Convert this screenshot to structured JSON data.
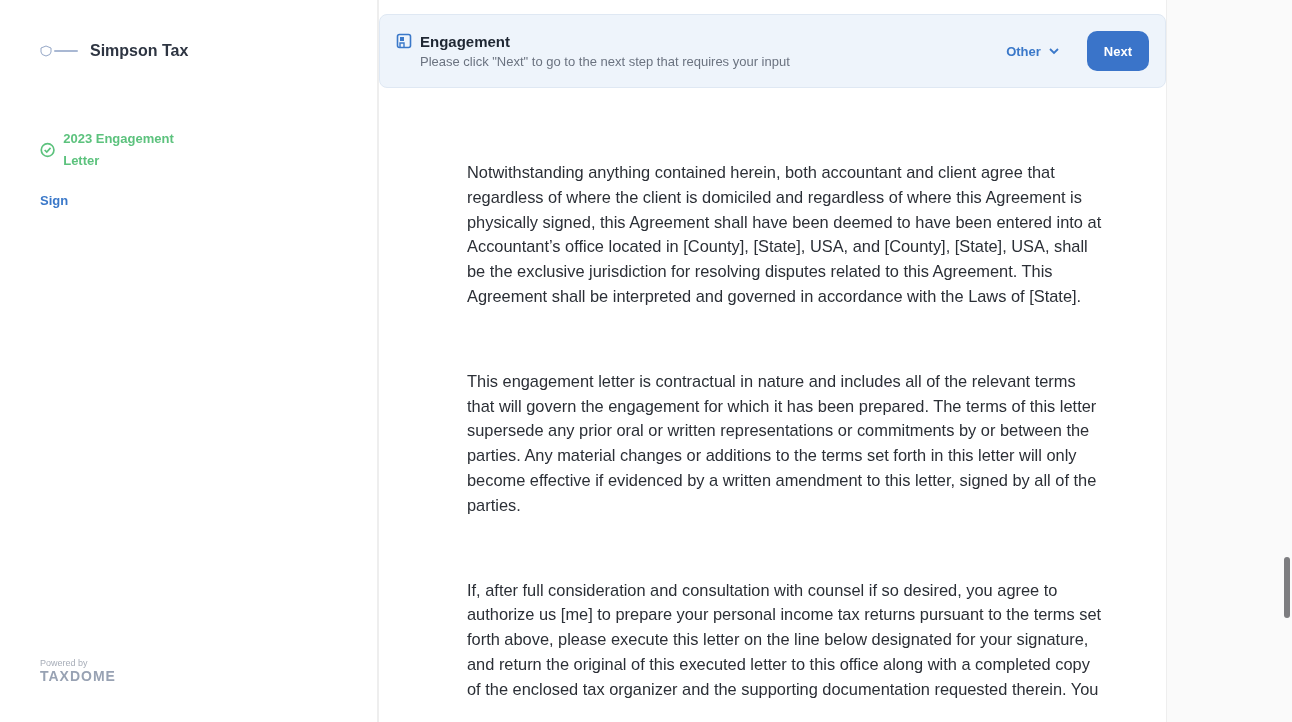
{
  "sidebar": {
    "brand": {
      "name": "Simpson Tax"
    },
    "steps": [
      {
        "label": "2023 Engagement Letter",
        "completed": true
      },
      {
        "label": "Sign",
        "completed": false
      }
    ],
    "footer": {
      "caption": "Powered by",
      "brand": "TAXDOME"
    }
  },
  "header": {
    "title": "Engagement",
    "subtitle": "Please click \"Next\" to go to the next step that requires your input",
    "menu": "Other",
    "button": "Next"
  },
  "document": {
    "paragraphs": [
      "Notwithstanding anything contained herein, both accountant and client agree that regardless of where the client is domiciled and regardless of where this Agreement is physically signed, this Agreement shall have been deemed to have been entered into at Accountant’s office located in [County], [State], USA, and [County], [State], USA, shall be the exclusive jurisdiction for resolving disputes related to this Agreement. This Agreement shall be interpreted and governed in accordance with the Laws of [State].",
      "This engagement letter is contractual in nature and includes all of the relevant terms that will govern the engagement for which it has been prepared. The terms of this letter supersede any prior oral or written representations or commitments by or between the parties. Any material changes or additions to the terms set forth in this letter will only become effective if evidenced by a written amendment to this letter, signed by all of the parties.",
      "If, after full consideration and consultation with counsel if so desired, you agree to authorize us [me] to prepare your personal income tax returns pursuant to the terms set forth above, please execute this letter on the line below designated for your signature, and return the original of this executed letter to this office along with a completed copy of the enclosed tax organizer and the supporting documentation requested therein. You"
    ]
  }
}
